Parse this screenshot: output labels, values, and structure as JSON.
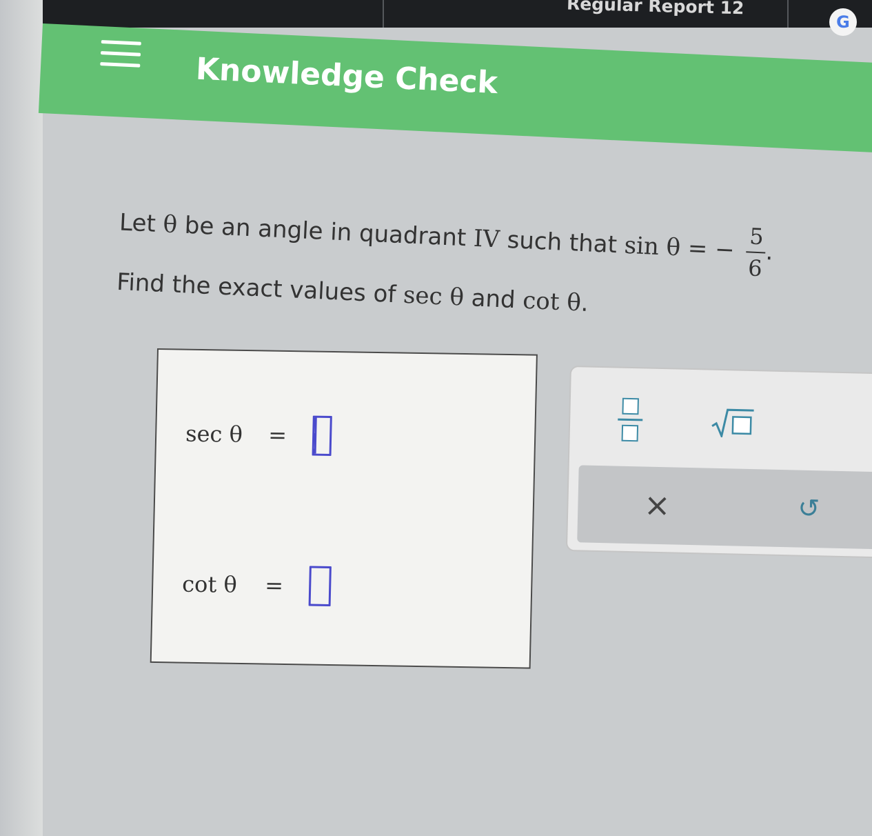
{
  "topbar": {
    "title": "Regular Report 12",
    "badge_letter": "G"
  },
  "header": {
    "title": "Knowledge Check",
    "bg_color": "#63c173"
  },
  "question": {
    "line1_prefix": "Let ",
    "theta": "θ",
    "line1_middle": " be an angle in quadrant ",
    "quadrant": "IV",
    "line1_suffix": " such that ",
    "sin_label": "sin θ",
    "equals_neg": " = − ",
    "frac_num": "5",
    "frac_den": "6",
    "line1_end": ".",
    "line2_prefix": "Find the exact values of ",
    "sec_label": "sec θ",
    "and_word": " and ",
    "cot_label": "cot θ",
    "line2_end": "."
  },
  "answers": {
    "sec": {
      "label": "sec θ",
      "eq": "=",
      "value": ""
    },
    "cot": {
      "label": "cot θ",
      "eq": "=",
      "value": ""
    }
  },
  "tools": {
    "fraction_icon": "fraction-icon",
    "sqrt_icon": "square-root-icon",
    "clear_glyph": "×",
    "undo_glyph": "↺",
    "accent_color": "#3c8aa5",
    "input_color": "#4a4acc"
  }
}
